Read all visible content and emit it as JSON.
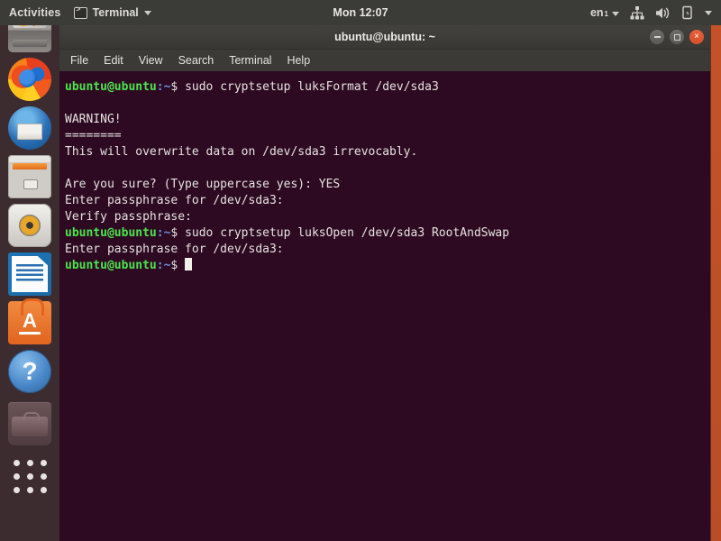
{
  "top_bar": {
    "activities_label": "Activities",
    "app_name": "Terminal",
    "app_icon": "terminal-icon",
    "clock": "Mon 12:07",
    "keyboard_layout": "en",
    "keyboard_layout_sub": "1",
    "icons": [
      "network-icon",
      "volume-icon",
      "battery-icon",
      "chevron-down-icon"
    ]
  },
  "dock": {
    "items": [
      {
        "label": "Disks",
        "icon": "disk-drive-icon"
      },
      {
        "label": "Firefox Web Browser",
        "icon": "firefox-icon"
      },
      {
        "label": "Thunderbird Mail",
        "icon": "thunderbird-icon"
      },
      {
        "label": "Files",
        "icon": "files-icon"
      },
      {
        "label": "Rhythmbox",
        "icon": "music-player-icon"
      },
      {
        "label": "LibreOffice Writer",
        "icon": "libreoffice-writer-icon"
      },
      {
        "label": "Ubuntu Software",
        "icon": "ubuntu-software-icon"
      },
      {
        "label": "Help",
        "icon": "help-icon"
      },
      {
        "label": "Trash",
        "icon": "trash-icon"
      },
      {
        "label": "Show Applications",
        "icon": "show-applications-icon"
      }
    ]
  },
  "window": {
    "title": "ubuntu@ubuntu: ~",
    "buttons": {
      "minimize": "minimize-button",
      "maximize": "maximize-button",
      "close_label": "×"
    },
    "menu": [
      "File",
      "Edit",
      "View",
      "Search",
      "Terminal",
      "Help"
    ]
  },
  "terminal": {
    "prompt_user": "ubuntu@ubuntu",
    "prompt_path": ":~",
    "prompt_sigil": "$ ",
    "lines": [
      {
        "type": "prompt",
        "command": "sudo cryptsetup luksFormat /dev/sda3"
      },
      {
        "type": "blank",
        "text": ""
      },
      {
        "type": "output",
        "text": "WARNING!"
      },
      {
        "type": "output",
        "text": "========"
      },
      {
        "type": "output",
        "text": "This will overwrite data on /dev/sda3 irrevocably."
      },
      {
        "type": "blank",
        "text": ""
      },
      {
        "type": "output",
        "text": "Are you sure? (Type uppercase yes): YES"
      },
      {
        "type": "output",
        "text": "Enter passphrase for /dev/sda3:"
      },
      {
        "type": "output",
        "text": "Verify passphrase:"
      },
      {
        "type": "prompt",
        "command": "sudo cryptsetup luksOpen /dev/sda3 RootAndSwap"
      },
      {
        "type": "output",
        "text": "Enter passphrase for /dev/sda3:"
      },
      {
        "type": "prompt-cursor",
        "command": ""
      }
    ]
  },
  "colors": {
    "terminal_bg": "#2d0a22",
    "dock_bg": "#3c2c30",
    "top_bar_bg": "#3b3b37",
    "titlebar_bg": "#3b3a36",
    "prompt_green": "#4ee44e",
    "prompt_blue": "#6a8fe0",
    "close_button": "#e8613a",
    "wallpaper_orange": "#c4532a"
  }
}
